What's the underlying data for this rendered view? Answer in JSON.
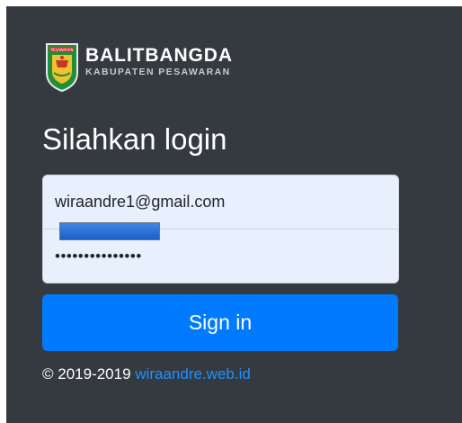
{
  "brand": {
    "name": "BALITBANGDA",
    "subtitle": "KABUPATEN PESAWARAN",
    "logo_icon": "pesawaran-shield-icon"
  },
  "heading": "Silahkan login",
  "form": {
    "email_value": "wiraandre1@gmail.com",
    "password_masked": "•••••••••••••••",
    "fill_color": "#e8f0fe"
  },
  "signin_button": {
    "label": "Sign in",
    "color": "#007bff"
  },
  "footer": {
    "copyright": "© 2019-2019",
    "link_text": "wiraandre.web.id",
    "link_color": "#1e90ff"
  },
  "colors": {
    "background": "#343a40"
  }
}
